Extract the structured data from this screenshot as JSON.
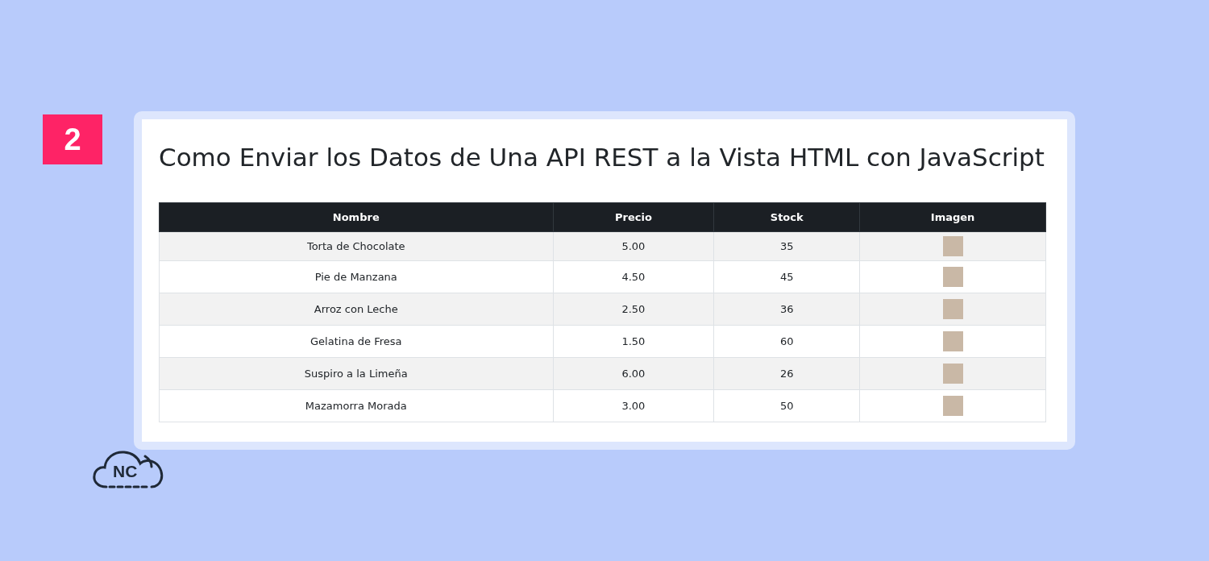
{
  "step_badge": "2",
  "page": {
    "title": "Como Enviar los Datos de Una API REST a la Vista HTML con JavaScript",
    "table": {
      "columns": [
        "Nombre",
        "Precio",
        "Stock",
        "Imagen"
      ],
      "rows": [
        {
          "nombre": "Torta de Chocolate",
          "precio": "5.00",
          "stock": "35"
        },
        {
          "nombre": "Pie de Manzana",
          "precio": "4.50",
          "stock": "45"
        },
        {
          "nombre": "Arroz con Leche",
          "precio": "2.50",
          "stock": "36"
        },
        {
          "nombre": "Gelatina de Fresa",
          "precio": "1.50",
          "stock": "60"
        },
        {
          "nombre": "Suspiro a la Limeña",
          "precio": "6.00",
          "stock": "26"
        },
        {
          "nombre": "Mazamorra Morada",
          "precio": "3.00",
          "stock": "50"
        }
      ]
    }
  },
  "logo": {
    "text": "NC"
  }
}
